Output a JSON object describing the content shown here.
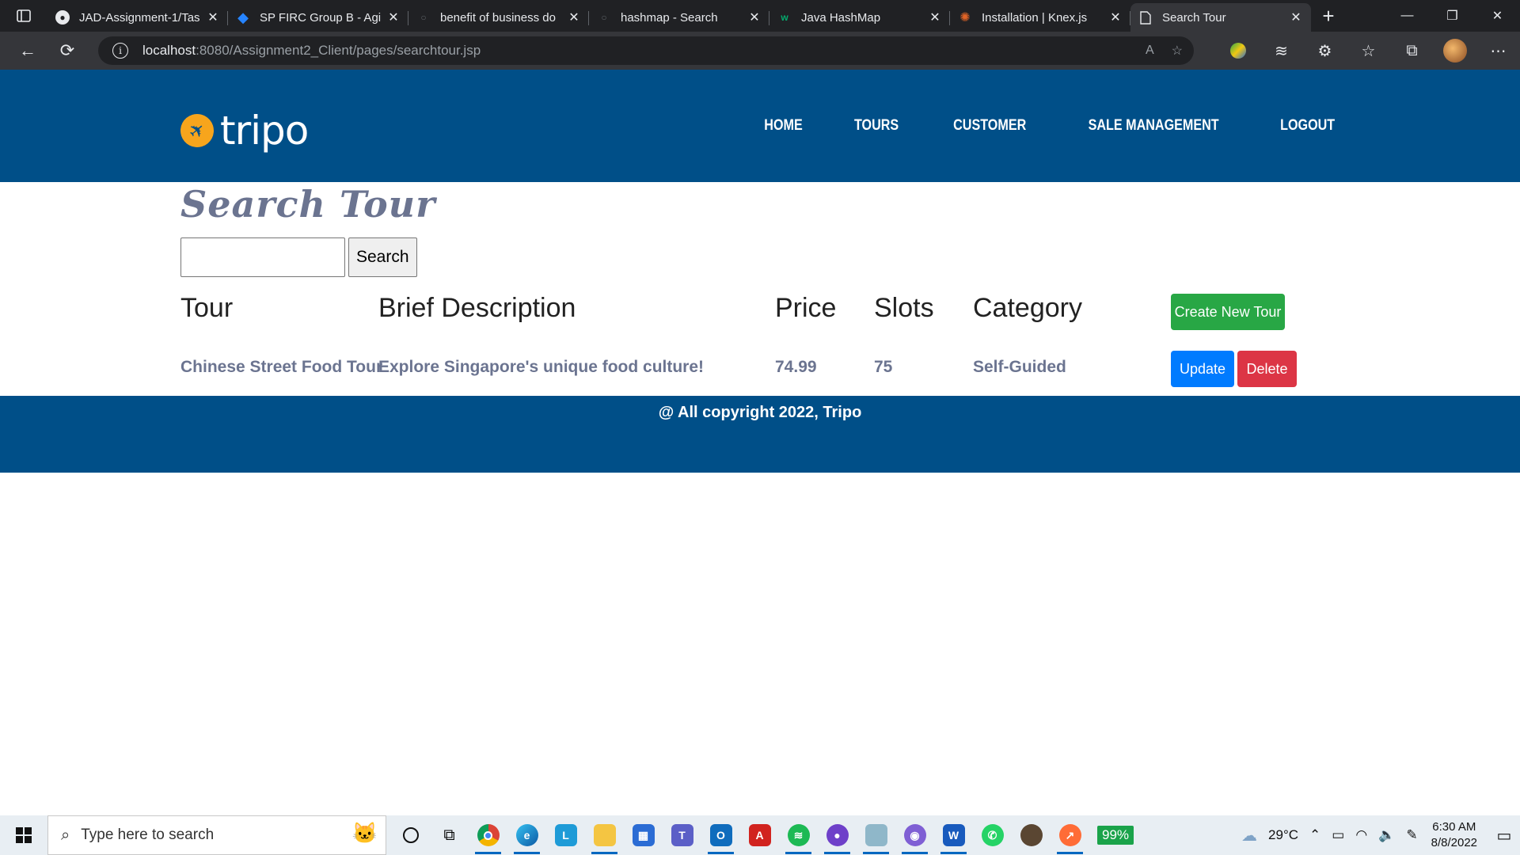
{
  "browser": {
    "tabs": [
      {
        "title": "JAD-Assignment-1/Tas",
        "icon": "github-icon",
        "active": false
      },
      {
        "title": "SP FIRC Group B - Agi",
        "icon": "jira-icon",
        "active": false
      },
      {
        "title": "benefit of business do",
        "icon": "search-icon",
        "active": false
      },
      {
        "title": "hashmap - Search",
        "icon": "search-icon",
        "active": false
      },
      {
        "title": "Java HashMap",
        "icon": "w3schools-icon",
        "active": false
      },
      {
        "title": "Installation | Knex.js",
        "icon": "knex-icon",
        "active": false
      },
      {
        "title": "Search Tour",
        "icon": "page-icon",
        "active": true
      }
    ],
    "url_host": "localhost",
    "url_rest": ":8080/Assignment2_Client/pages/searchtour.jsp"
  },
  "site": {
    "logo": "tripo",
    "nav": [
      "HOME",
      "TOURS",
      "CUSTOMER",
      "SALE MANAGEMENT",
      "LOGOUT"
    ],
    "page_title": "Search Tour",
    "search_button": "Search",
    "search_value": "",
    "table": {
      "headers": [
        "Tour",
        "Brief Description",
        "Price",
        "Slots",
        "Category"
      ],
      "create_button": "Create New Tour",
      "rows": [
        {
          "tour": "Chinese Street Food Tour",
          "description": "Explore Singapore's unique food culture!",
          "price": "74.99",
          "slots": "75",
          "category": "Self-Guided",
          "update": "Update",
          "delete": "Delete"
        }
      ]
    },
    "footer": "@ All copyright 2022, Tripo",
    "colors": {
      "header": "#004f88",
      "create": "#28a745",
      "update": "#007bff",
      "delete": "#dc3545",
      "accent": "#f7a51c"
    }
  },
  "taskbar": {
    "search_placeholder": "Type here to search",
    "battery_pill": "99%",
    "temperature": "29°C",
    "time": "6:30 AM",
    "date": "8/8/2022"
  }
}
